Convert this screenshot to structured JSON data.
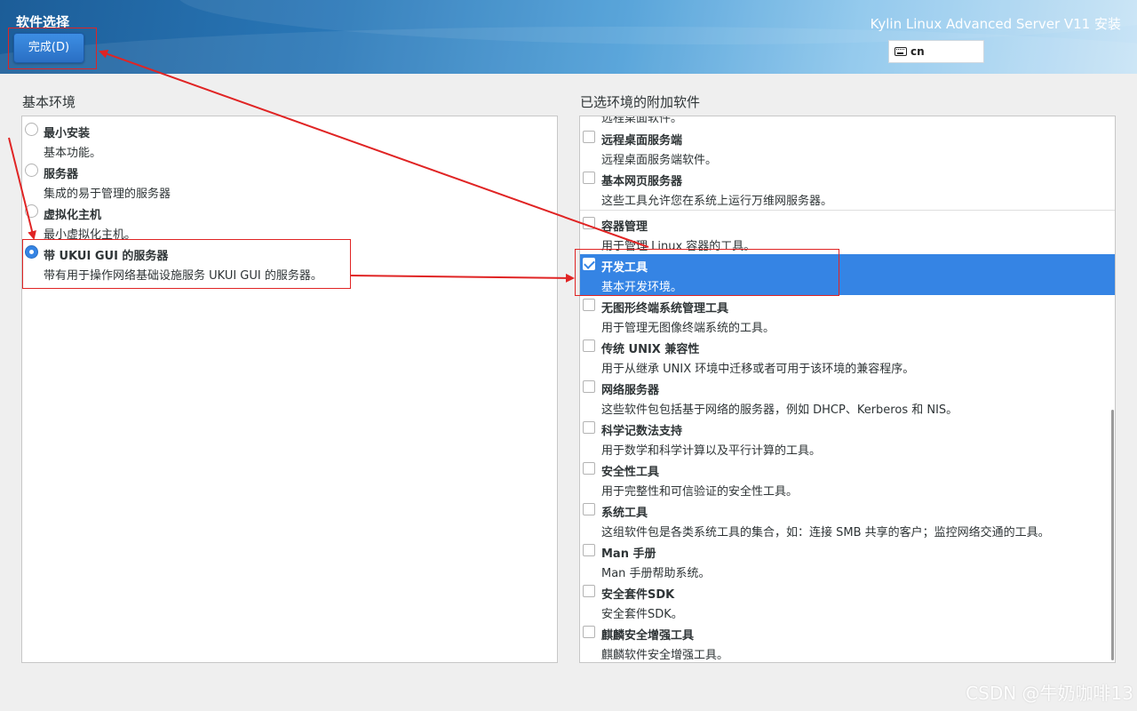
{
  "header": {
    "page_title": "软件选择",
    "done_label": "完成(D)",
    "product_title": "Kylin Linux Advanced Server V11 安装",
    "keyboard_layout": "cn"
  },
  "base_environment": {
    "label": "基本环境",
    "items": [
      {
        "title": "最小安装",
        "desc": "基本功能。",
        "selected": false
      },
      {
        "title": "服务器",
        "desc": "集成的易于管理的服务器",
        "selected": false
      },
      {
        "title": "虚拟化主机",
        "desc": "最小虚拟化主机。",
        "selected": false
      },
      {
        "title": "带 UKUI GUI 的服务器",
        "desc": "带有用于操作网络基础设施服务 UKUI GUI 的服务器。",
        "selected": true
      }
    ]
  },
  "addons": {
    "label": "已选环境的附加软件",
    "partial_top_text": "远程桌面软件。",
    "items": [
      {
        "title": "远程桌面服务端",
        "desc": "远程桌面服务端软件。",
        "checked": false
      },
      {
        "title": "基本网页服务器",
        "desc": "这些工具允许您在系统上运行万维网服务器。",
        "checked": false
      },
      {
        "title": "容器管理",
        "desc": "用于管理 Linux 容器的工具。",
        "checked": false
      },
      {
        "title": "开发工具",
        "desc": "基本开发环境。",
        "checked": true
      },
      {
        "title": "无图形终端系统管理工具",
        "desc": "用于管理无图像终端系统的工具。",
        "checked": false
      },
      {
        "title": "传统 UNIX 兼容性",
        "desc": "用于从继承 UNIX 环境中迁移或者可用于该环境的兼容程序。",
        "checked": false
      },
      {
        "title": "网络服务器",
        "desc": "这些软件包包括基于网络的服务器，例如 DHCP、Kerberos 和 NIS。",
        "checked": false
      },
      {
        "title": "科学记数法支持",
        "desc": "用于数学和科学计算以及平行计算的工具。",
        "checked": false
      },
      {
        "title": "安全性工具",
        "desc": "用于完整性和可信验证的安全性工具。",
        "checked": false
      },
      {
        "title": "系统工具",
        "desc": "这组软件包是各类系统工具的集合，如：连接 SMB 共享的客户；监控网络交通的工具。",
        "checked": false
      },
      {
        "title": "Man 手册",
        "desc": "Man 手册帮助系统。",
        "checked": false
      },
      {
        "title": "安全套件SDK",
        "desc": "安全套件SDK。",
        "checked": false
      },
      {
        "title": "麒麟安全增强工具",
        "desc": "麒麟软件安全增强工具。",
        "checked": false
      }
    ]
  },
  "watermark": "CSDN @牛奶咖啡13",
  "colors": {
    "accent": "#3584e4",
    "annotation": "#e02424",
    "header_dark": "#1c5d98"
  }
}
